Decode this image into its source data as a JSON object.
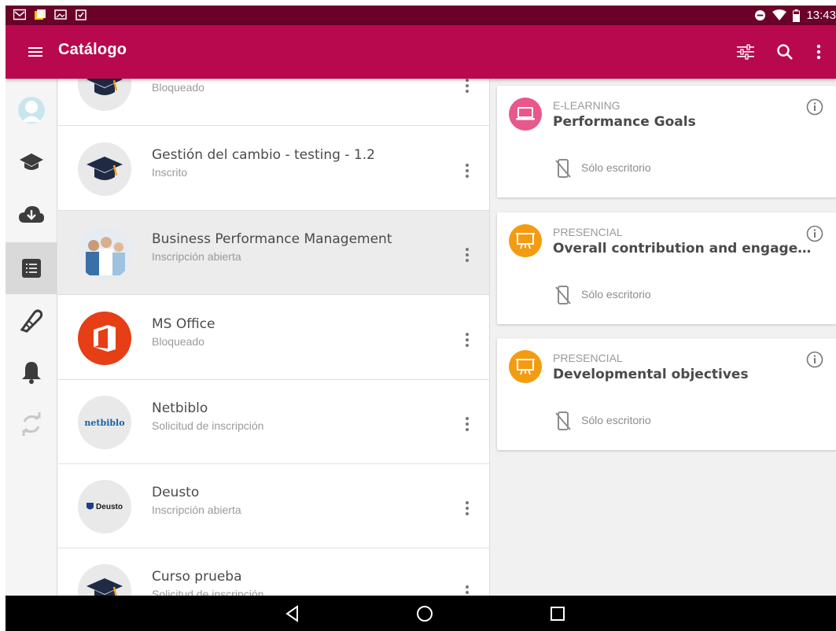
{
  "status_bar": {
    "time": "13:43",
    "left_icons": [
      "gmail-icon",
      "files-icon",
      "image-icon",
      "clipboard-check-icon"
    ],
    "right_icons": [
      "dnd-icon",
      "wifi-icon",
      "battery-icon"
    ]
  },
  "app_bar": {
    "title": "Catálogo",
    "actions": [
      "filter-icon",
      "search-icon",
      "more-vert-icon"
    ]
  },
  "rail": {
    "items": [
      "avatar-icon",
      "graduation-cap-icon",
      "cloud-download-icon",
      "catalog-list-icon",
      "certificate-icon",
      "bell-icon",
      "sync-icon"
    ],
    "selected": "catalog-list-icon"
  },
  "courses": [
    {
      "name": "",
      "status": "Bloqueado",
      "avatar": "cap"
    },
    {
      "name": " Gestión del cambio - testing - 1.2",
      "status": "Inscrito",
      "avatar": "cap"
    },
    {
      "name": "Business Performance Management",
      "status": "Inscripción abierta",
      "avatar": "people"
    },
    {
      "name": "MS Office",
      "status": "Bloqueado",
      "avatar": "office"
    },
    {
      "name": "Netbiblo",
      "status": "Solicitud de inscripción",
      "avatar": "netbiblo",
      "logo_text": "netbiblo"
    },
    {
      "name": "Deusto",
      "status": "Inscripción abierta",
      "avatar": "deusto",
      "logo_text": "Deusto"
    },
    {
      "name": "Curso prueba",
      "status": "Solicitud de inscripción",
      "avatar": "cap"
    }
  ],
  "activities": [
    {
      "type": "E-LEARNING",
      "title": "Performance Goals",
      "device_note": "Sólo escritorio",
      "color": "#e8588a",
      "icon": "laptop-icon"
    },
    {
      "type": "PRESENCIAL",
      "title": "Overall contribution and engagement",
      "device_note": "Sólo escritorio",
      "color": "#f39c12",
      "icon": "presentation-icon"
    },
    {
      "type": "PRESENCIAL",
      "title": "Developmental objectives",
      "device_note": "Sólo escritorio",
      "color": "#f39c12",
      "icon": "presentation-icon"
    }
  ],
  "colors": {
    "status_bar": "#6b0029",
    "app_bar": "#b8094e",
    "elearning": "#e8588a",
    "presencial": "#f39c12"
  },
  "nav_bar": {
    "buttons": [
      "back-icon",
      "home-icon",
      "recents-icon"
    ]
  }
}
